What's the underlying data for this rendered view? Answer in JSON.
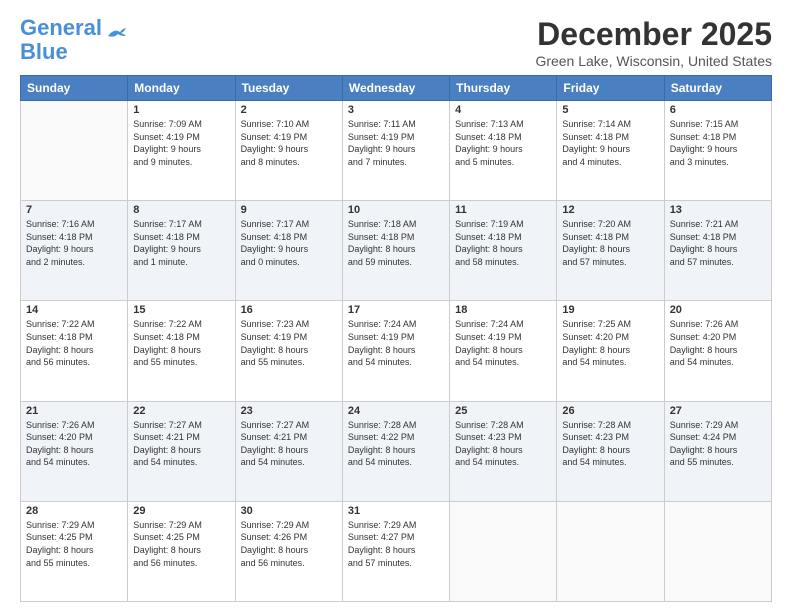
{
  "logo": {
    "line1": "General",
    "line2": "Blue"
  },
  "title": "December 2025",
  "location": "Green Lake, Wisconsin, United States",
  "days_of_week": [
    "Sunday",
    "Monday",
    "Tuesday",
    "Wednesday",
    "Thursday",
    "Friday",
    "Saturday"
  ],
  "weeks": [
    [
      {
        "day": "",
        "content": ""
      },
      {
        "day": "1",
        "content": "Sunrise: 7:09 AM\nSunset: 4:19 PM\nDaylight: 9 hours\nand 9 minutes."
      },
      {
        "day": "2",
        "content": "Sunrise: 7:10 AM\nSunset: 4:19 PM\nDaylight: 9 hours\nand 8 minutes."
      },
      {
        "day": "3",
        "content": "Sunrise: 7:11 AM\nSunset: 4:19 PM\nDaylight: 9 hours\nand 7 minutes."
      },
      {
        "day": "4",
        "content": "Sunrise: 7:13 AM\nSunset: 4:18 PM\nDaylight: 9 hours\nand 5 minutes."
      },
      {
        "day": "5",
        "content": "Sunrise: 7:14 AM\nSunset: 4:18 PM\nDaylight: 9 hours\nand 4 minutes."
      },
      {
        "day": "6",
        "content": "Sunrise: 7:15 AM\nSunset: 4:18 PM\nDaylight: 9 hours\nand 3 minutes."
      }
    ],
    [
      {
        "day": "7",
        "content": "Sunrise: 7:16 AM\nSunset: 4:18 PM\nDaylight: 9 hours\nand 2 minutes."
      },
      {
        "day": "8",
        "content": "Sunrise: 7:17 AM\nSunset: 4:18 PM\nDaylight: 9 hours\nand 1 minute."
      },
      {
        "day": "9",
        "content": "Sunrise: 7:17 AM\nSunset: 4:18 PM\nDaylight: 9 hours\nand 0 minutes."
      },
      {
        "day": "10",
        "content": "Sunrise: 7:18 AM\nSunset: 4:18 PM\nDaylight: 8 hours\nand 59 minutes."
      },
      {
        "day": "11",
        "content": "Sunrise: 7:19 AM\nSunset: 4:18 PM\nDaylight: 8 hours\nand 58 minutes."
      },
      {
        "day": "12",
        "content": "Sunrise: 7:20 AM\nSunset: 4:18 PM\nDaylight: 8 hours\nand 57 minutes."
      },
      {
        "day": "13",
        "content": "Sunrise: 7:21 AM\nSunset: 4:18 PM\nDaylight: 8 hours\nand 57 minutes."
      }
    ],
    [
      {
        "day": "14",
        "content": "Sunrise: 7:22 AM\nSunset: 4:18 PM\nDaylight: 8 hours\nand 56 minutes."
      },
      {
        "day": "15",
        "content": "Sunrise: 7:22 AM\nSunset: 4:18 PM\nDaylight: 8 hours\nand 55 minutes."
      },
      {
        "day": "16",
        "content": "Sunrise: 7:23 AM\nSunset: 4:19 PM\nDaylight: 8 hours\nand 55 minutes."
      },
      {
        "day": "17",
        "content": "Sunrise: 7:24 AM\nSunset: 4:19 PM\nDaylight: 8 hours\nand 54 minutes."
      },
      {
        "day": "18",
        "content": "Sunrise: 7:24 AM\nSunset: 4:19 PM\nDaylight: 8 hours\nand 54 minutes."
      },
      {
        "day": "19",
        "content": "Sunrise: 7:25 AM\nSunset: 4:20 PM\nDaylight: 8 hours\nand 54 minutes."
      },
      {
        "day": "20",
        "content": "Sunrise: 7:26 AM\nSunset: 4:20 PM\nDaylight: 8 hours\nand 54 minutes."
      }
    ],
    [
      {
        "day": "21",
        "content": "Sunrise: 7:26 AM\nSunset: 4:20 PM\nDaylight: 8 hours\nand 54 minutes."
      },
      {
        "day": "22",
        "content": "Sunrise: 7:27 AM\nSunset: 4:21 PM\nDaylight: 8 hours\nand 54 minutes."
      },
      {
        "day": "23",
        "content": "Sunrise: 7:27 AM\nSunset: 4:21 PM\nDaylight: 8 hours\nand 54 minutes."
      },
      {
        "day": "24",
        "content": "Sunrise: 7:28 AM\nSunset: 4:22 PM\nDaylight: 8 hours\nand 54 minutes."
      },
      {
        "day": "25",
        "content": "Sunrise: 7:28 AM\nSunset: 4:23 PM\nDaylight: 8 hours\nand 54 minutes."
      },
      {
        "day": "26",
        "content": "Sunrise: 7:28 AM\nSunset: 4:23 PM\nDaylight: 8 hours\nand 54 minutes."
      },
      {
        "day": "27",
        "content": "Sunrise: 7:29 AM\nSunset: 4:24 PM\nDaylight: 8 hours\nand 55 minutes."
      }
    ],
    [
      {
        "day": "28",
        "content": "Sunrise: 7:29 AM\nSunset: 4:25 PM\nDaylight: 8 hours\nand 55 minutes."
      },
      {
        "day": "29",
        "content": "Sunrise: 7:29 AM\nSunset: 4:25 PM\nDaylight: 8 hours\nand 56 minutes."
      },
      {
        "day": "30",
        "content": "Sunrise: 7:29 AM\nSunset: 4:26 PM\nDaylight: 8 hours\nand 56 minutes."
      },
      {
        "day": "31",
        "content": "Sunrise: 7:29 AM\nSunset: 4:27 PM\nDaylight: 8 hours\nand 57 minutes."
      },
      {
        "day": "",
        "content": ""
      },
      {
        "day": "",
        "content": ""
      },
      {
        "day": "",
        "content": ""
      }
    ]
  ]
}
